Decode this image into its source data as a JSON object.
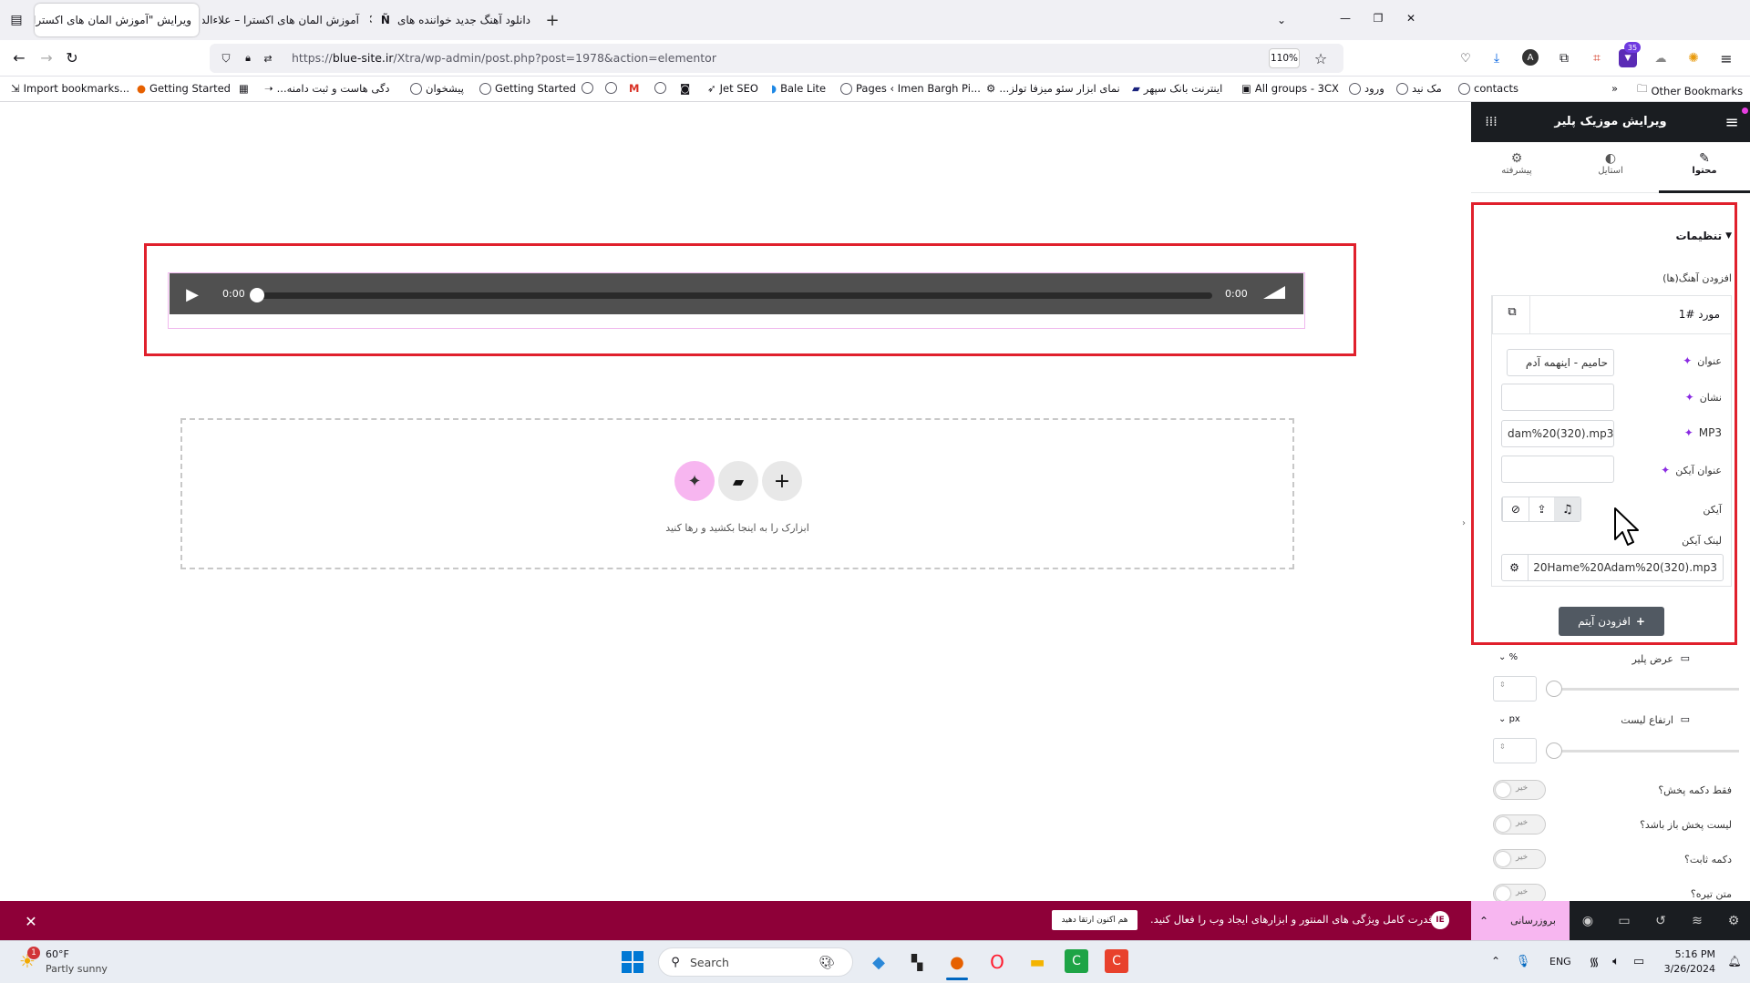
{
  "browser": {
    "tabs": [
      {
        "label": "ویرایش \"آموزش المان های اکسترا – ",
        "active": true
      },
      {
        "label": "آموزش المان های اکسترا – علاءالدین",
        "active": false
      },
      {
        "label": "دانلود آهنگ جدید خواننده های ",
        "active": false
      }
    ],
    "url_prefix": "https://",
    "url_host": "blue-site.ir",
    "url_path": "/Xtra/wp-admin/post.php?post=1978&action=elementor",
    "zoom": "110%",
    "badge_count": "35",
    "bookmarks": [
      "Import bookmarks...",
      "Getting Started",
      "...دگی هاست و ثبت دامنه",
      "پیشخوان",
      "Getting Started",
      "Jet SEO",
      "Bale Lite",
      "Pages ‹ Imen Bargh Pi...",
      "...نمای ابزار سئو میزفا تولز",
      "اینترنت بانک سپهر",
      "All groups - 3CX",
      "ورود",
      "مک نید",
      "contacts"
    ],
    "other_bookmarks": "Other Bookmarks"
  },
  "player": {
    "current_time": "0:00",
    "duration": "0:00"
  },
  "dropzone": {
    "hint": "ابزارک را به اینجا بکشید و رها کنید"
  },
  "panel": {
    "title": "ویرایش موزیک پلیر",
    "tabs": {
      "content": "محتوا",
      "style": "استایل",
      "advanced": "پیشرفته"
    },
    "section_title": "تنظیمات",
    "add_tracks_label": "افزودن آهنگ(ها)",
    "item_title": "مورد #1",
    "fields": {
      "title_label": "عنوان",
      "title_value": "حامیم - اینهمه آدم",
      "badge_label": "نشان",
      "badge_value": "",
      "mp3_label": "MP3",
      "mp3_value": "dam%20(320).mp3",
      "icon_title_label": "عنوان آیکن",
      "icon_title_value": "",
      "icon_label": "آیکن",
      "icon_link_label": "لینک آیکن",
      "icon_link_value": "20Hame%20Adam%20(320).mp3"
    },
    "add_item_button": "افزودن آیتم",
    "player_width_label": "عرض پلیر",
    "player_width_unit": "%",
    "list_height_label": "ارتفاع لیست",
    "list_height_unit": "px",
    "toggles": [
      {
        "label": "فقط دکمه پخش؟",
        "state": "خیر"
      },
      {
        "label": "لیست پخش باز باشد؟",
        "state": "خیر"
      },
      {
        "label": "دکمه ثابت؟",
        "state": "خیر"
      },
      {
        "label": "متن تیره؟",
        "state": "خیر"
      }
    ],
    "update_button": "بروزرسانی"
  },
  "notice": {
    "text": "قدرت کامل ویژگی های المنتور و ابزارهای ایجاد وب را فعال کنید.",
    "button": "هم اکنون ارتقا دهید"
  },
  "taskbar": {
    "weather_temp": "60°F",
    "weather_desc": "Partly sunny",
    "weather_badge": "1",
    "search_placeholder": "Search",
    "lang": "ENG",
    "time": "5:16 PM",
    "date": "3/26/2024"
  },
  "colors": {
    "highlight_red": "#e0202c",
    "notice_bg": "#8e0038",
    "panel_dark": "#1a1d21",
    "ai_pink": "#f7b6f0"
  }
}
